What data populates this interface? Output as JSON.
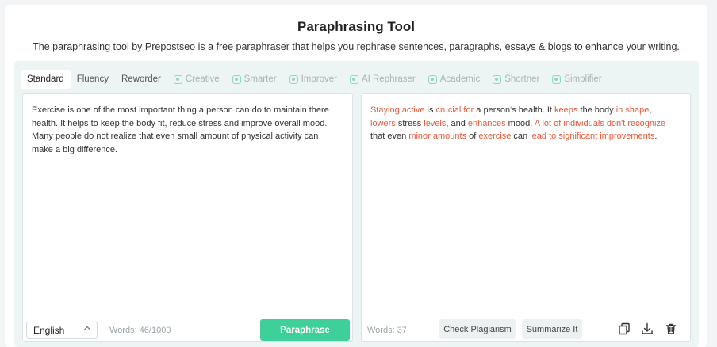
{
  "header": {
    "title": "Paraphrasing Tool",
    "subtitle": "The paraphrasing tool by Prepostseo is a free paraphraser that helps you rephrase sentences, paragraphs, essays & blogs to enhance your writing."
  },
  "modes": [
    {
      "label": "Standard",
      "active": true,
      "locked": false
    },
    {
      "label": "Fluency",
      "active": false,
      "locked": false
    },
    {
      "label": "Reworder",
      "active": false,
      "locked": false
    },
    {
      "label": "Creative",
      "active": false,
      "locked": true
    },
    {
      "label": "Smarter",
      "active": false,
      "locked": true
    },
    {
      "label": "Improver",
      "active": false,
      "locked": true
    },
    {
      "label": "AI Rephraser",
      "active": false,
      "locked": true
    },
    {
      "label": "Academic",
      "active": false,
      "locked": true
    },
    {
      "label": "Shortner",
      "active": false,
      "locked": true
    },
    {
      "label": "Simplifier",
      "active": false,
      "locked": true
    }
  ],
  "input": {
    "text": "Exercise is one of the most important thing a person can do to maintain there health. It helps to keep the body fit, reduce stress and improve overall mood. Many people do not realize that even small amount of physical activity can make a big difference.",
    "language": "English",
    "word_count": "Words: 46/1000",
    "paraphrase_label": "Paraphrase"
  },
  "output": {
    "segments": [
      {
        "text": "Staying active",
        "changed": true
      },
      {
        "text": " is ",
        "changed": false
      },
      {
        "text": "crucial for",
        "changed": true
      },
      {
        "text": " a person",
        "changed": false
      },
      {
        "text": "'",
        "changed": true
      },
      {
        "text": "s health. It ",
        "changed": false
      },
      {
        "text": "keeps",
        "changed": true
      },
      {
        "text": " the body ",
        "changed": false
      },
      {
        "text": "in shape",
        "changed": true
      },
      {
        "text": ", ",
        "changed": false
      },
      {
        "text": "lowers",
        "changed": true
      },
      {
        "text": " stress ",
        "changed": false
      },
      {
        "text": "levels",
        "changed": true
      },
      {
        "text": ", and ",
        "changed": false
      },
      {
        "text": "enhances",
        "changed": true
      },
      {
        "text": " mood. ",
        "changed": false
      },
      {
        "text": "A lot of individuals don't recognize",
        "changed": true
      },
      {
        "text": " that even ",
        "changed": false
      },
      {
        "text": "minor amounts",
        "changed": true
      },
      {
        "text": " of ",
        "changed": false
      },
      {
        "text": "exercise",
        "changed": true
      },
      {
        "text": " can ",
        "changed": false
      },
      {
        "text": "lead to significant improvements",
        "changed": true
      },
      {
        "text": ".",
        "changed": false
      }
    ],
    "word_count": "Words: 37",
    "check_plagiarism_label": "Check Plagiarism",
    "summarize_label": "Summarize It"
  },
  "icons": {
    "copy": "copy-icon",
    "download": "download-icon",
    "delete": "trash-icon"
  },
  "colors": {
    "accent": "#3fd09a",
    "changed_text": "#e05a3b"
  }
}
